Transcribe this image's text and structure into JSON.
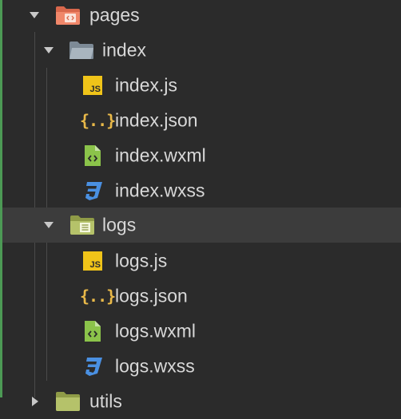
{
  "tree": {
    "pages": {
      "label": "pages"
    },
    "index": {
      "label": "index"
    },
    "index_js": {
      "label": "index.js",
      "badge": "JS"
    },
    "index_json": {
      "label": "index.json",
      "badge": "{..}"
    },
    "index_wxml": {
      "label": "index.wxml"
    },
    "index_wxss": {
      "label": "index.wxss"
    },
    "logs": {
      "label": "logs"
    },
    "logs_js": {
      "label": "logs.js",
      "badge": "JS"
    },
    "logs_json": {
      "label": "logs.json",
      "badge": "{..}"
    },
    "logs_wxml": {
      "label": "logs.wxml"
    },
    "logs_wxss": {
      "label": "logs.wxss"
    },
    "utils": {
      "label": "utils"
    }
  },
  "colors": {
    "background": "#2b2b2b",
    "selected_row": "#3c3c3c",
    "js_badge": "#f0c419",
    "json_brace": "#e9b949",
    "wxml_icon": "#8bc34a",
    "css_icon": "#4a90e2",
    "pages_folder": "#e8785c",
    "index_folder": "#8c9aa6",
    "logs_folder": "#b5c26a"
  }
}
